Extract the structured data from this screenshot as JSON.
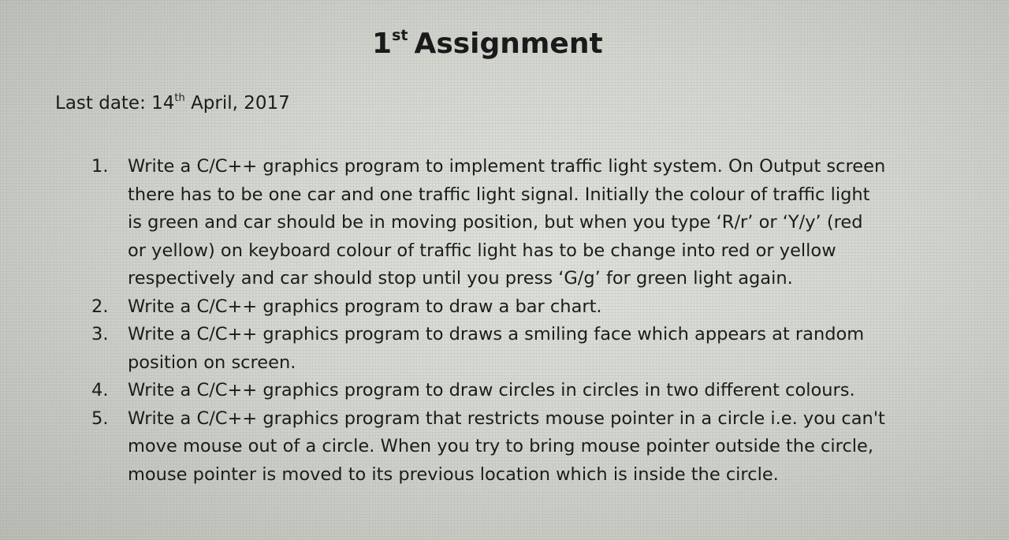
{
  "title": {
    "sup": "st",
    "main": "Assignment",
    "number": "1"
  },
  "last_date": {
    "label": "Last date: 14",
    "sup": "th",
    "rest": " April, 2017"
  },
  "items": [
    {
      "number": "1.",
      "lines": [
        "Write a C/C++ graphics program to implement traffic light system. On Output screen",
        "there has to be one car and one traffic light signal. Initially the colour of traffic light",
        "is green and car should be in moving position, but when you type ‘R/r’ or ‘Y/y’ (red",
        "or yellow) on keyboard colour of traffic light has to be change into red or yellow",
        "respectively and car should stop until you press ‘G/g’ for green light again."
      ]
    },
    {
      "number": "2.",
      "lines": [
        "Write a C/C++ graphics program to draw a bar chart."
      ]
    },
    {
      "number": "3.",
      "lines": [
        "Write a C/C++ graphics program to draws a smiling face which appears at random",
        "position on screen."
      ]
    },
    {
      "number": "4.",
      "lines": [
        "Write a C/C++ graphics program to draw circles in circles in two different colours."
      ]
    },
    {
      "number": "5.",
      "lines": [
        "Write a C/C++ graphics program that restricts mouse pointer in a circle i.e. you can't",
        "move mouse out of a circle. When you try to bring mouse pointer outside the circle,",
        "mouse pointer is moved to its previous location which is inside the circle."
      ]
    }
  ]
}
